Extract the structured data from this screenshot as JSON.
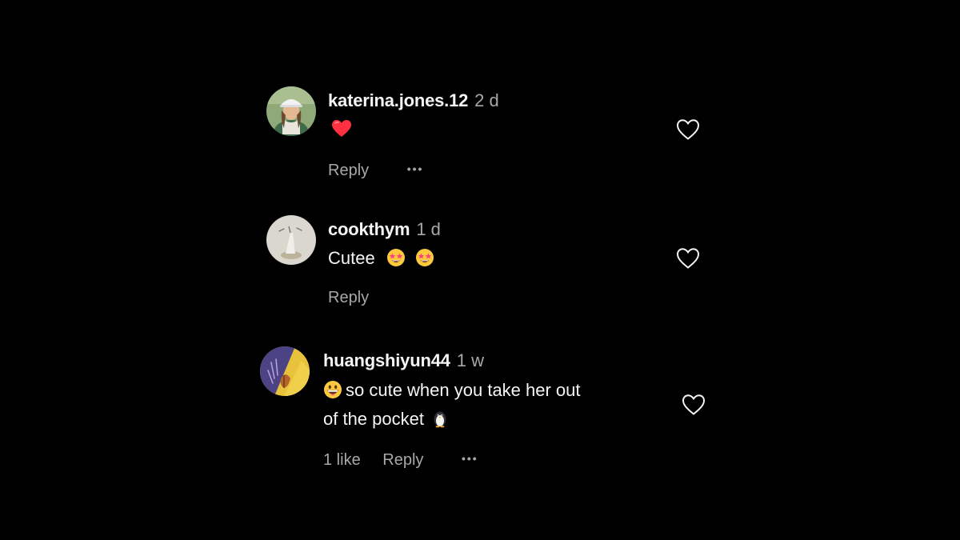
{
  "comments": [
    {
      "username": "katerina.jones.12",
      "time": "2 d",
      "text": "",
      "emoji": "red-heart",
      "actions": {
        "reply_label": "Reply",
        "more_label": "•••"
      },
      "like_icon": "heart-outline-icon"
    },
    {
      "username": "cookthym",
      "time": "1 d",
      "text": "Cutee",
      "emoji": "star-struck x2",
      "actions": {
        "reply_label": "Reply"
      },
      "like_icon": "heart-outline-icon"
    },
    {
      "username": "huangshiyun44",
      "time": "1 w",
      "text_line1": "so cute when you take her out",
      "text_line2": "of the pocket",
      "leading_emoji": "grinning-face",
      "trailing_emoji": "penguin",
      "actions": {
        "likes_label": "1 like",
        "reply_label": "Reply",
        "more_label": "•••"
      },
      "like_icon": "heart-outline-icon"
    }
  ],
  "colors": {
    "background": "#000000",
    "primary_text": "#f5f5f5",
    "secondary_text": "#a8a8a8",
    "heart_red": "#ff3040"
  }
}
